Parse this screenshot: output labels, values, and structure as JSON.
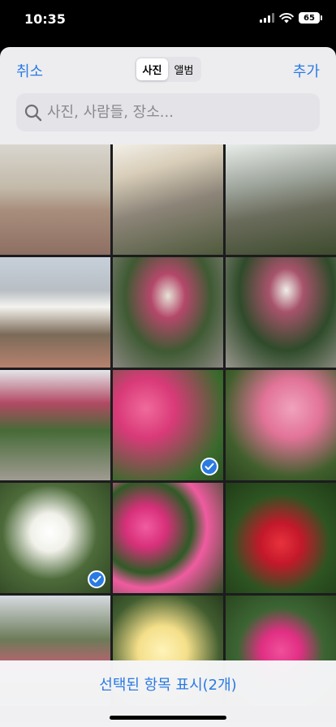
{
  "status": {
    "time": "10:35",
    "battery": "65"
  },
  "header": {
    "cancel_label": "취소",
    "add_label": "추가",
    "tabs": [
      {
        "label": "사진",
        "active": true
      },
      {
        "label": "앨범",
        "active": false
      }
    ]
  },
  "search": {
    "placeholder": "사진, 사람들, 장소..."
  },
  "photos": [
    {
      "subject": "plaza-fountain",
      "selected": false
    },
    {
      "subject": "market-tents-walkway",
      "selected": false
    },
    {
      "subject": "railing-street",
      "selected": false
    },
    {
      "subject": "apartments-tents",
      "selected": false
    },
    {
      "subject": "rose-arch-walkway",
      "selected": false
    },
    {
      "subject": "rose-arch-tunnel",
      "selected": false
    },
    {
      "subject": "rose-arch-long",
      "selected": false
    },
    {
      "subject": "pink-roses-cluster",
      "selected": true
    },
    {
      "subject": "pink-roses-closeup",
      "selected": false
    },
    {
      "subject": "white-roses",
      "selected": true
    },
    {
      "subject": "magenta-roses",
      "selected": false
    },
    {
      "subject": "red-roses",
      "selected": false
    },
    {
      "subject": "rose-garden",
      "selected": false
    },
    {
      "subject": "yellow-roses",
      "selected": false
    },
    {
      "subject": "single-pink-rose",
      "selected": false
    }
  ],
  "footer": {
    "show_selected_label": "선택된 항목 표시(2개)"
  },
  "colors": {
    "accent": "#2a7ae2"
  }
}
